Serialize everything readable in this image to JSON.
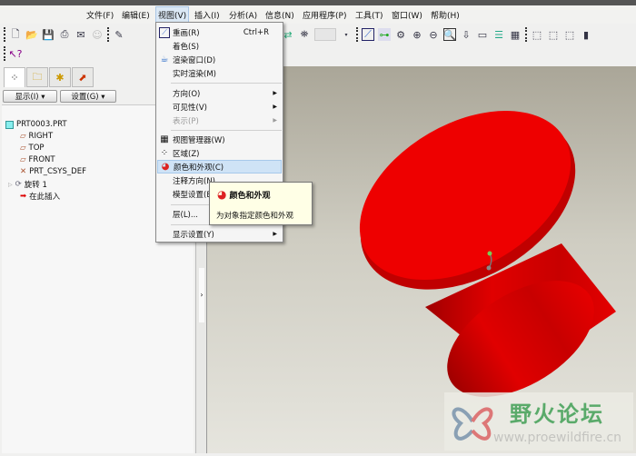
{
  "menubar": [
    "文件(F)",
    "编辑(E)",
    "视图(V)",
    "插入(I)",
    "分析(A)",
    "信息(N)",
    "应用程序(P)",
    "工具(T)",
    "窗口(W)",
    "帮助(H)"
  ],
  "left_panel": {
    "show_label": "显示(I) ▾",
    "settings_label": "设置(G) ▾"
  },
  "tree": {
    "root": "PRT0003.PRT",
    "items": [
      "RIGHT",
      "TOP",
      "FRONT",
      "PRT_CSYS_DEF",
      "旋转 1",
      "在此插入"
    ]
  },
  "view_menu": {
    "items": [
      {
        "label": "重画(R)",
        "shortcut": "Ctrl+R"
      },
      {
        "label": "着色(S)"
      },
      {
        "label": "渲染窗口(D)"
      },
      {
        "label": "实时渲染(M)"
      },
      {
        "label": "方向(O)"
      },
      {
        "label": "可见性(V)"
      },
      {
        "label": "表示(P)"
      },
      {
        "label": "视图管理器(W)"
      },
      {
        "label": "区域(Z)"
      },
      {
        "label": "颜色和外观(C)"
      },
      {
        "label": "注释方向(N)"
      },
      {
        "label": "模型设置(E)"
      },
      {
        "label": "层(L)..."
      },
      {
        "label": "显示设置(Y)"
      }
    ]
  },
  "tooltip": {
    "title": "颜色和外观",
    "description": "为对象指定颜色和外观"
  },
  "watermark": {
    "name": "野火论坛",
    "url": "www.proewildfire.cn"
  },
  "colors": {
    "model": "#e80000",
    "highlight": "#cfe3f6"
  }
}
